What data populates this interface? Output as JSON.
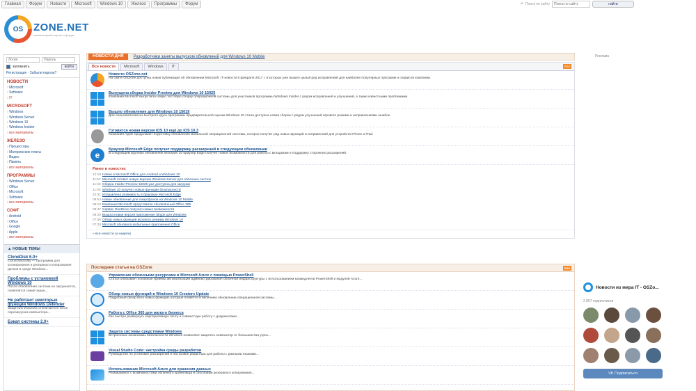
{
  "topnav": [
    "Главная",
    "Форум",
    "Новости",
    "Microsoft",
    "Windows 10",
    "Железо",
    "Программы",
    "Форум"
  ],
  "search": {
    "placeholder": "Поиск по сайту",
    "button": "найти"
  },
  "logo": {
    "os": "OS",
    "name": "ZONE.NET",
    "tagline": "компьютерный портал и форум"
  },
  "login": {
    "user_placeholder": "Логин",
    "pass_placeholder": "Пароль",
    "remember": "запомнить",
    "button": "войти",
    "links": "Регистрация · Забыли пароль?"
  },
  "sidebar": [
    {
      "title": "Новости",
      "items": [
        "Microsoft",
        "Software",
        "IT"
      ]
    },
    {
      "title": "Microsoft",
      "items": [
        "Windows",
        "Windows Server",
        "Windows 10",
        "Windows Insider",
        "все материалы"
      ]
    },
    {
      "title": "Железо",
      "items": [
        "Процессоры",
        "Материнские платы",
        "Видео",
        "Память",
        "все материалы"
      ]
    },
    {
      "title": "Программы",
      "items": [
        "Windows Server",
        "Office",
        "Microsoft",
        "Software",
        "все материалы"
      ]
    },
    {
      "title": "Софт",
      "items": [
        "Android",
        "Office",
        "Google",
        "Apple",
        "все материалы"
      ]
    }
  ],
  "new_topics": {
    "title": "НОВЫЕ ТЕМЫ",
    "items": [
      {
        "title": "CloneDisk 6.0+",
        "desc": "CloneDiskUtility — программа для клонирования и резервного копирования дисков в среде Windows..."
      },
      {
        "title": "Проблемы с установкой Windows 10",
        "desc": "После обновления система не загружается, появляется синий экран..."
      },
      {
        "title": "Не работают некоторые функции Windows Defender",
        "desc": "Защитник Windows отключается после перезагрузки компьютера..."
      },
      {
        "title": "Бэкап системы 2.0+",
        "desc": ""
      }
    ]
  },
  "headline": {
    "label": "НОВОСТИ ДНЯ",
    "ticker": "Разработчики заняты выпуском обновлений для Windows 10 Mobile"
  },
  "tabs": [
    "Все новости",
    "Microsoft",
    "Windows",
    "IT"
  ],
  "rss": "RSS",
  "news": [
    {
      "icon": "os-icon",
      "title": "Новости OSZone.net",
      "desc": "На сайте OSZone доступна новая публикация об обновлении Microsoft. IT-новости 6 февраля 2017 г. в которых уже вышел целый ряд исправлений для наиболее популярных программ и сервисов компании."
    },
    {
      "icon": "windows-icon",
      "title": "Выпущена сборка Insider Preview для Windows 10 15025",
      "desc": "Компания Microsoft выпустила новую тестовую сборку операционной системы для участников программы Windows Insider с рядом исправлений и улучшений, а также известными проблемами."
    },
    {
      "icon": "windows-icon",
      "title": "Вышло обновление для Windows 10 15019",
      "desc": "Для пользователей из быстрого круга программы предварительной оценки Windows 10 стала доступна новая сборка с рядом улучшений игрового режима и исправлениями ошибок."
    },
    {
      "icon": "apple-icon",
      "title": "Готовится новая версия iOS 10 ещё до iOS 10.3",
      "desc": "Компания Apple продолжает подготовку обновления мобильной операционной системы, которое получит ряд новых функций и исправлений для устройств iPhone и iPad."
    },
    {
      "icon": "edge-icon",
      "title": "Браузер Microsoft Edge получит поддержку расширений в следующем обновлении",
      "desc": "В следующем крупном обновлении Windows 10 браузер Edge получит новые возможности для работы с вкладками и поддержку сторонних расширений."
    }
  ],
  "recent": {
    "title": "Ранее в новостях",
    "items": [
      {
        "time": "12:18",
        "text": "Новое в Microsoft Office для Android и Windows 10"
      },
      {
        "time": "11:52",
        "text": "Microsoft готовит новую версию Windows Server для облачных систем"
      },
      {
        "time": "11:40",
        "text": "Сборка Insider Preview 15025 уже доступна для загрузки"
      },
      {
        "time": "11:05",
        "text": "Windows 10 получит новые функции безопасности"
      },
      {
        "time": "10:31",
        "text": "Исправлена уязвимость в браузере Microsoft Edge"
      },
      {
        "time": "09:54",
        "text": "Новое обновление для смартфонов на Windows 10 Mobile"
      },
      {
        "time": "09:12",
        "text": "Компания Microsoft представила обновлённый Office 365"
      },
      {
        "time": "08:47",
        "text": "Сервис OneDrive получил новые возможности"
      },
      {
        "time": "08:20",
        "text": "Вышла новая версия приложения Skype для Windows"
      },
      {
        "time": "07:58",
        "text": "Обзор новых функций игрового режима Windows 10"
      },
      {
        "time": "07:33",
        "text": "Microsoft обновила мобильные приложения Office"
      }
    ]
  },
  "box_footer": "» все новости за неделю",
  "section2": {
    "title": "Последние статьи на OSZone",
    "items": [
      {
        "icon": "cloud-icon",
        "title": "Управление облачными ресурсами в Microsoft Azure с помощью PowerShell",
        "desc": "Статья описывает основные приёмы автоматизации администрирования облачной инфраструктуры с использованием командлетов PowerShell и модулей Azure..."
      },
      {
        "icon": "circle-icon",
        "title": "Обзор новых функций в Windows 10 Creators Update",
        "desc": "Подробный обзор всех новых функций, которые появятся в весеннем обновлении операционной системы..."
      },
      {
        "icon": "circle-icon",
        "title": "Работа с Office 365 для малого бизнеса",
        "desc": "Как быстро развернуть корпоративную почту и совместную работу с документами..."
      },
      {
        "icon": "windows-icon",
        "title": "Защита системы средствами Windows",
        "desc": "Встроенные механизмы безопасности Windows позволяют защитить компьютер от большинства угроз..."
      },
      {
        "icon": "vs-icon",
        "title": "Visual Studio Code: настройка среды разработки",
        "desc": "Руководство по установке расширений и настройке редактора для работы с разными языками..."
      },
      {
        "icon": "azure-icon",
        "title": "Использование Microsoft Azure для хранения данных",
        "desc": "Разбираемся с возможностями облачного хранилища и способами резервного копирования..."
      }
    ]
  },
  "ad_label": "Реклама",
  "vk": {
    "title": "Новости из мира IT - OSZo...",
    "subscribers": "2 857 подписчиков",
    "button": "Подписаться"
  },
  "colors": {
    "accent": "#e8702a",
    "link": "#1a4f8a",
    "section": "#c0392b"
  }
}
